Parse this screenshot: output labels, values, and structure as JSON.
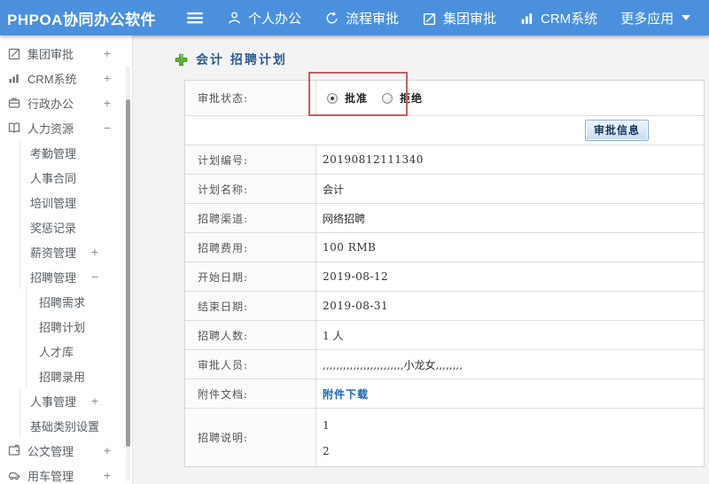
{
  "topbar": {
    "logo": "PHPOA协同办公软件",
    "nav": [
      {
        "label": "个人办公",
        "icon": "user-icon"
      },
      {
        "label": "流程审批",
        "icon": "cycle-arrow-icon"
      },
      {
        "label": "集团审批",
        "icon": "edit-square-icon"
      },
      {
        "label": "CRM系统",
        "icon": "bar-chart-icon"
      },
      {
        "label": "更多应用",
        "icon": "caret-down-icon"
      }
    ]
  },
  "sidebar": {
    "items": [
      {
        "label": "集团审批",
        "toggle": "+",
        "level": 1,
        "icon": "edit-square-icon"
      },
      {
        "label": "CRM系统",
        "toggle": "+",
        "level": 1,
        "icon": "bar-chart-icon"
      },
      {
        "label": "行政办公",
        "toggle": "+",
        "level": 1,
        "icon": "briefcase-icon"
      },
      {
        "label": "人力资源",
        "toggle": "−",
        "level": 1,
        "icon": "book-icon"
      },
      {
        "label": "考勤管理",
        "toggle": "",
        "level": 2
      },
      {
        "label": "人事合同",
        "toggle": "",
        "level": 2
      },
      {
        "label": "培训管理",
        "toggle": "",
        "level": 2
      },
      {
        "label": "奖惩记录",
        "toggle": "",
        "level": 2
      },
      {
        "label": "薪资管理",
        "toggle": "+",
        "level": 2
      },
      {
        "label": "招聘管理",
        "toggle": "−",
        "level": 2
      },
      {
        "label": "招聘需求",
        "toggle": "",
        "level": 3
      },
      {
        "label": "招聘计划",
        "toggle": "",
        "level": 3
      },
      {
        "label": "人才库",
        "toggle": "",
        "level": 3
      },
      {
        "label": "招聘录用",
        "toggle": "",
        "level": 3
      },
      {
        "label": "人事管理",
        "toggle": "+",
        "level": 2
      },
      {
        "label": "基础类别设置",
        "toggle": "+",
        "level": 2
      },
      {
        "label": "公文管理",
        "toggle": "+",
        "level": 1,
        "icon": "document-wallet-icon"
      },
      {
        "label": "用车管理",
        "toggle": "+",
        "level": 1,
        "icon": "car-icon"
      }
    ]
  },
  "main": {
    "breadcrumb": {
      "plus_icon": "green-plus-icon",
      "title": "会计 招聘计划"
    },
    "form": {
      "status_label": "审批状态:",
      "radio_options": [
        {
          "label": "批准",
          "checked": true
        },
        {
          "label": "拒绝",
          "checked": false
        }
      ],
      "approve_button": "审批信息",
      "rows": [
        {
          "label": "计划编号:",
          "value": "20190812111340"
        },
        {
          "label": "计划名称:",
          "value": "会计"
        },
        {
          "label": "招聘渠道:",
          "value": "网络招聘"
        },
        {
          "label": "招聘费用:",
          "value": "100 RMB"
        },
        {
          "label": "开始日期:",
          "value": "2019-08-12"
        },
        {
          "label": "结束日期:",
          "value": "2019-08-31"
        },
        {
          "label": "招聘人数:",
          "value": "1 人"
        },
        {
          "label": "审批人员:",
          "value": ",,,,,,,,,,,,,,,,,,,,,,,,小龙女,,,,,,,,"
        },
        {
          "label": "附件文档:",
          "value": "附件下载"
        },
        {
          "label": "招聘说明:",
          "value_lines": [
            "1",
            "2"
          ]
        }
      ]
    }
  },
  "colors": {
    "topbar_blue": "#4a90dc",
    "annotation_red": "#c0605f",
    "link_blue": "#1a66b3",
    "breadcrumb_blue": "#2b5c8e",
    "plus_green": "#54b335"
  }
}
